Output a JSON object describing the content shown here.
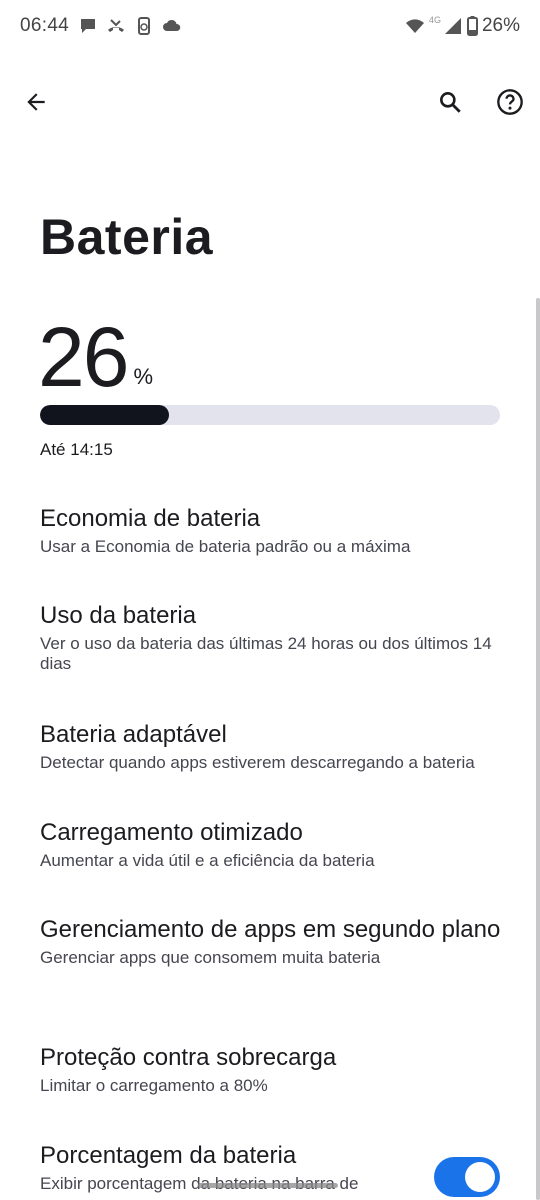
{
  "status_bar": {
    "time": "06:44",
    "network_label": "4G",
    "battery_text": "26%",
    "icons": [
      "chat-bubble-icon",
      "missed-call-icon",
      "phone-sync-icon",
      "cloud-icon",
      "wifi-icon",
      "cell-signal-icon",
      "battery-icon"
    ]
  },
  "app_bar": {
    "back_icon": "arrow-left-icon",
    "search_icon": "search-icon",
    "help_icon": "help-circle-icon"
  },
  "page": {
    "title": "Bateria"
  },
  "battery": {
    "level": "26",
    "unit": "%",
    "level_fraction": 0.26,
    "until": "Até 14:15"
  },
  "items": [
    {
      "title": "Economia de bateria",
      "summary": "Usar a Economia de bateria padrão ou a máxima"
    },
    {
      "title": "Uso da bateria",
      "summary": "Ver o uso da bateria das últimas 24 horas ou dos últimos 14 dias"
    },
    {
      "title": "Bateria adaptável",
      "summary": "Detectar quando apps estiverem descarregando a bateria"
    },
    {
      "title": "Carregamento otimizado",
      "summary": "Aumentar a vida útil e a eficiência da bateria"
    },
    {
      "title": "Gerenciamento de apps em segundo plano",
      "summary": "Gerenciar apps que consomem muita bateria"
    },
    {
      "title": "Proteção contra sobrecarga",
      "summary": "Limitar o carregamento a 80%"
    },
    {
      "title": "Porcentagem da bateria",
      "summary": "Exibir porcentagem da bateria na barra de",
      "toggle_on": true
    }
  ],
  "colors": {
    "accent": "#1a73e8",
    "bar_fill": "#11141c",
    "bar_track": "#e2e3ed"
  }
}
